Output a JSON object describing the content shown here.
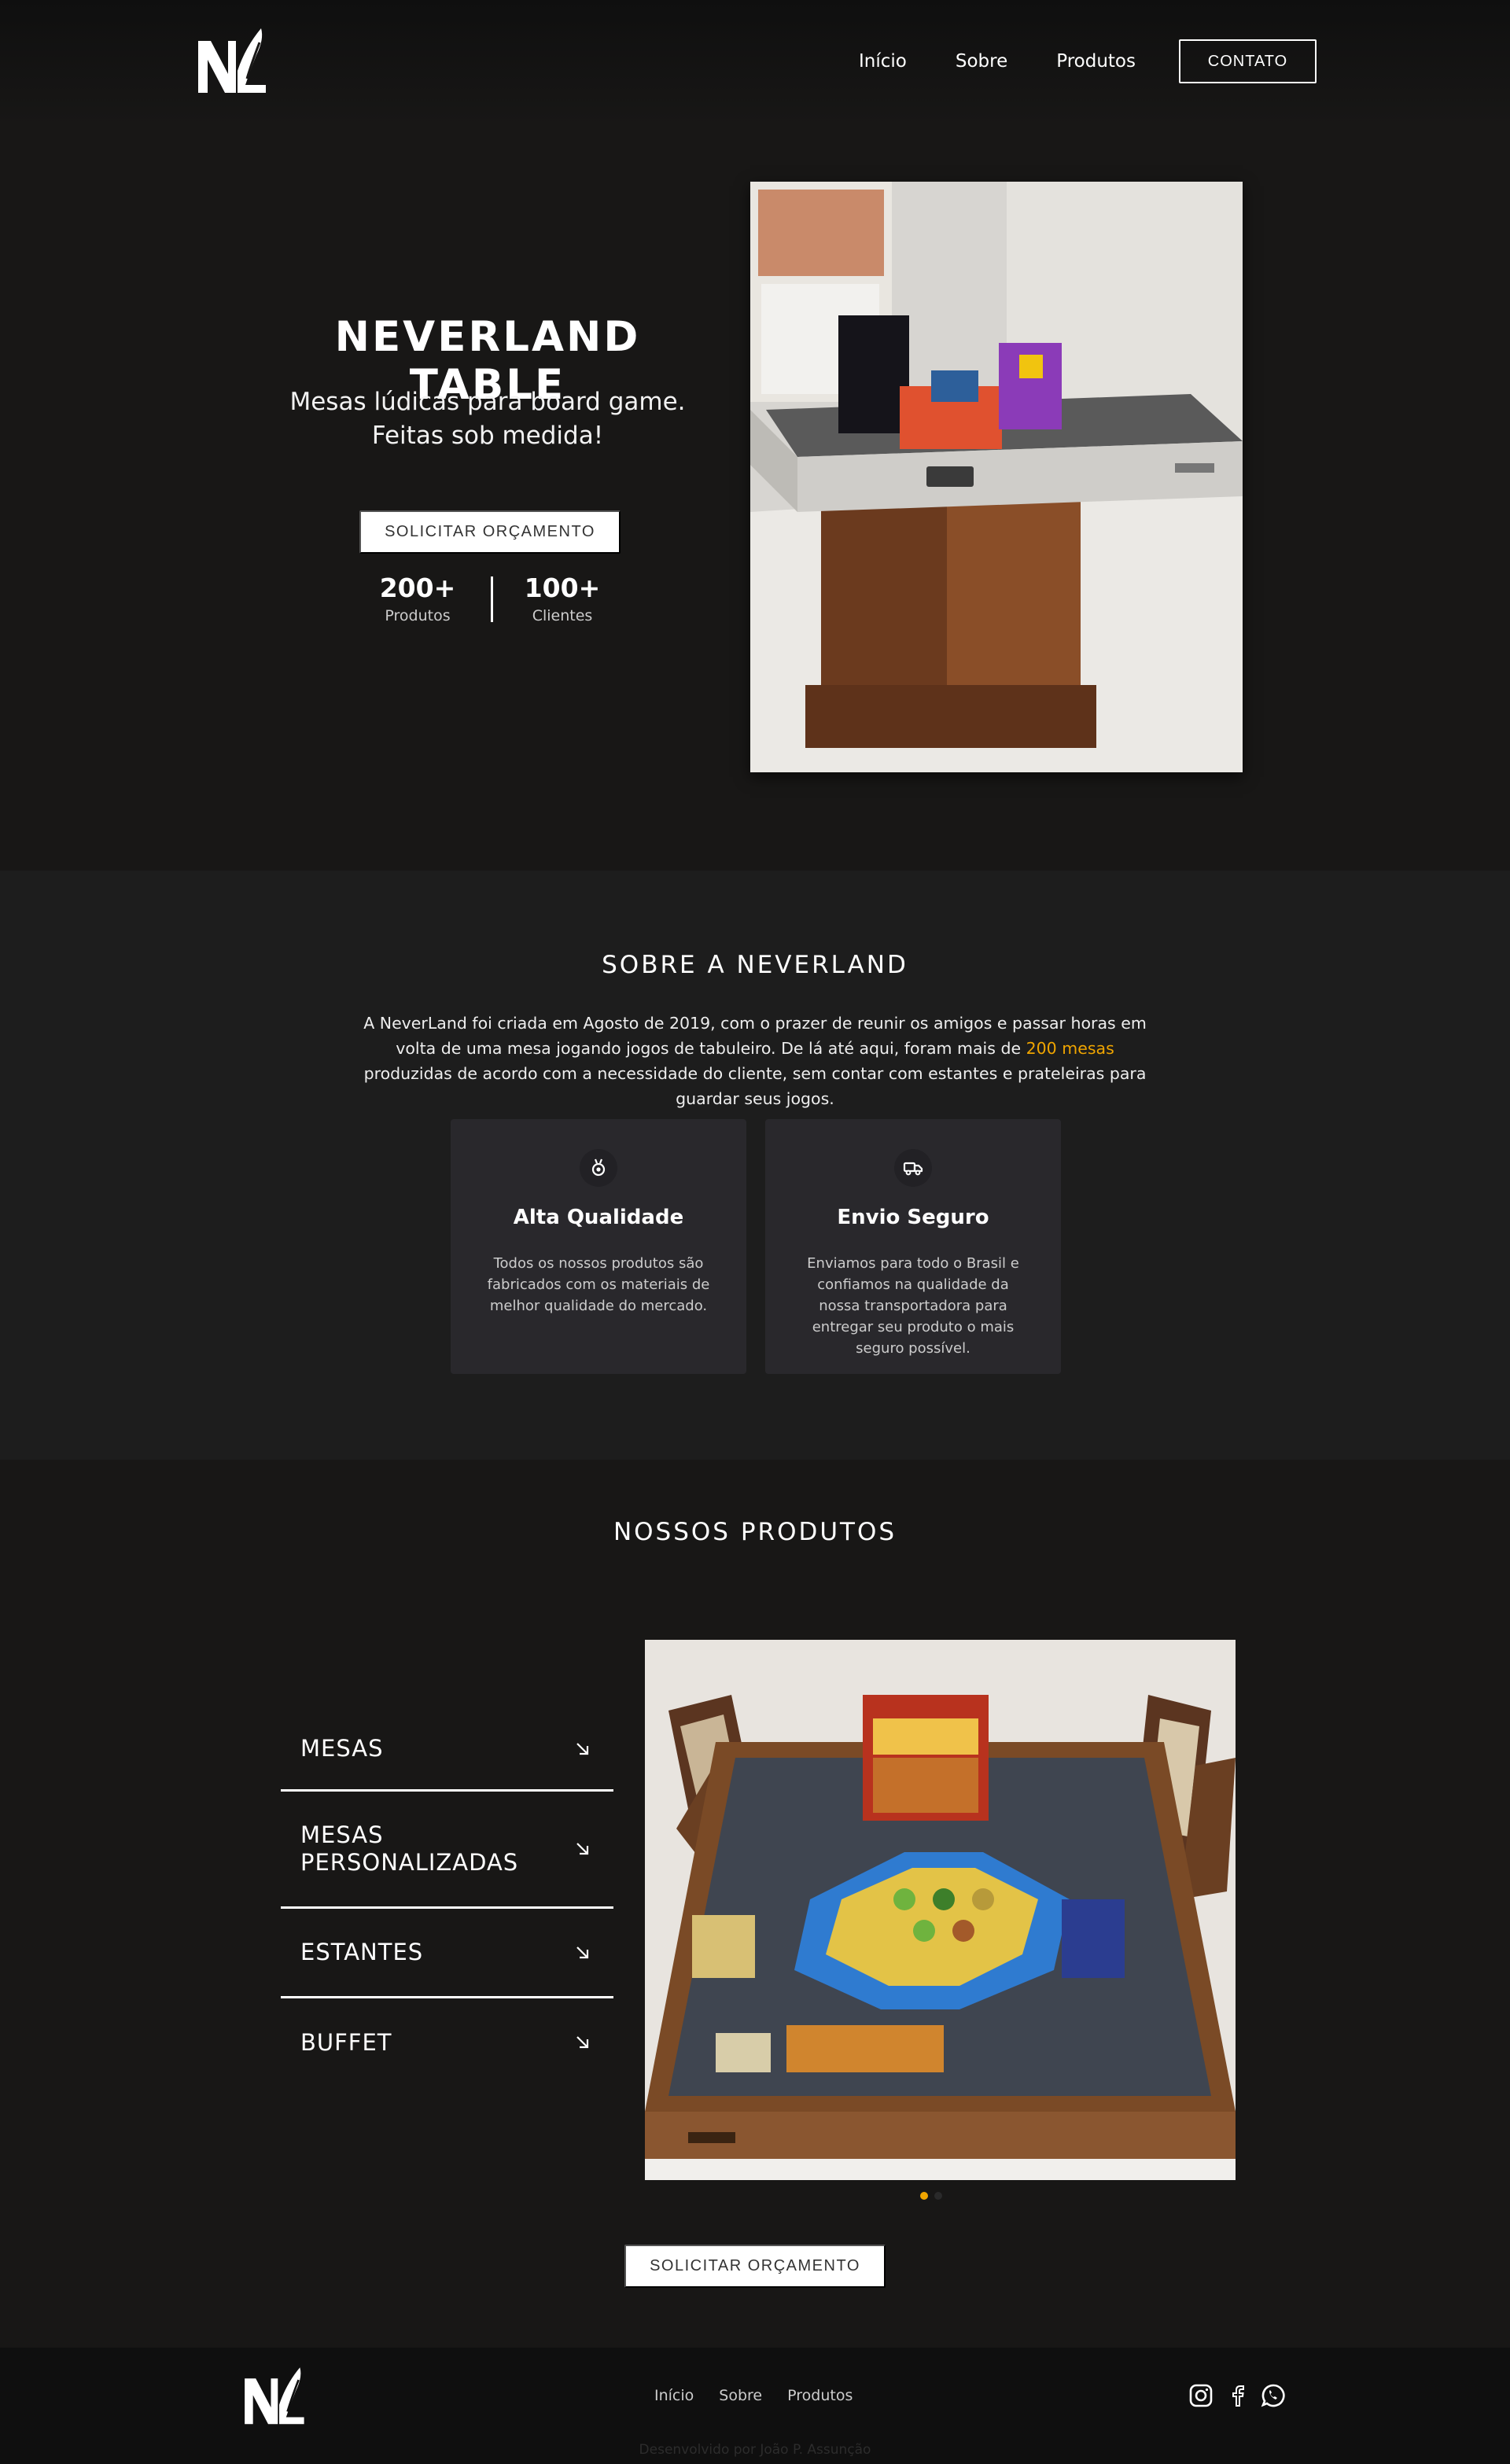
{
  "nav": {
    "links": [
      "Início",
      "Sobre",
      "Produtos"
    ],
    "contact_label": "CONTATO"
  },
  "hero": {
    "title": "NEVERLAND TABLE",
    "subtitle_line1": "Mesas lúdicas para board game.",
    "subtitle_line2": "Feitas sob medida!",
    "cta_label": "SOLICITAR ORÇAMENTO",
    "stats": [
      {
        "value": "200+",
        "label": "Produtos"
      },
      {
        "value": "100+",
        "label": "Clientes"
      }
    ],
    "image_icon": "photo-table-with-board-games"
  },
  "about": {
    "title": "SOBRE A NEVERLAND",
    "text_before": "A NeverLand foi criada em Agosto de 2019, com o prazer de reunir os amigos e passar horas em volta de uma mesa jogando jogos de tabuleiro. De lá até aqui, foram mais de ",
    "text_highlight": "200 mesas",
    "text_after": " produzidas de acordo com a necessidade do cliente, sem contar com estantes e prateleiras para guardar seus jogos.",
    "highlight_color": "#f0a500",
    "cards": [
      {
        "icon": "medal-icon",
        "title": "Alta Qualidade",
        "text": "Todos os nossos produtos são fabricados com os materiais de melhor qualidade do mercado."
      },
      {
        "icon": "truck-icon",
        "title": "Envio Seguro",
        "text": "Enviamos para todo o Brasil e confiamos na qualidade da nossa transportadora para entregar seu produto o mais seguro possível."
      }
    ]
  },
  "products": {
    "title": "NOSSOS PRODUTOS",
    "items": [
      "MESAS",
      "MESAS PERSONALIZADAS",
      "ESTANTES",
      "BUFFET"
    ],
    "image_icon": "photo-table-with-catan-game",
    "carousel_active_color": "#f0a500",
    "cta_label": "SOLICITAR ORÇAMENTO"
  },
  "footer": {
    "links": [
      "Início",
      "Sobre",
      "Produtos"
    ],
    "social": [
      "instagram-icon",
      "facebook-icon",
      "whatsapp-icon"
    ],
    "credit": "Desenvolvido por João P. Assunção"
  }
}
